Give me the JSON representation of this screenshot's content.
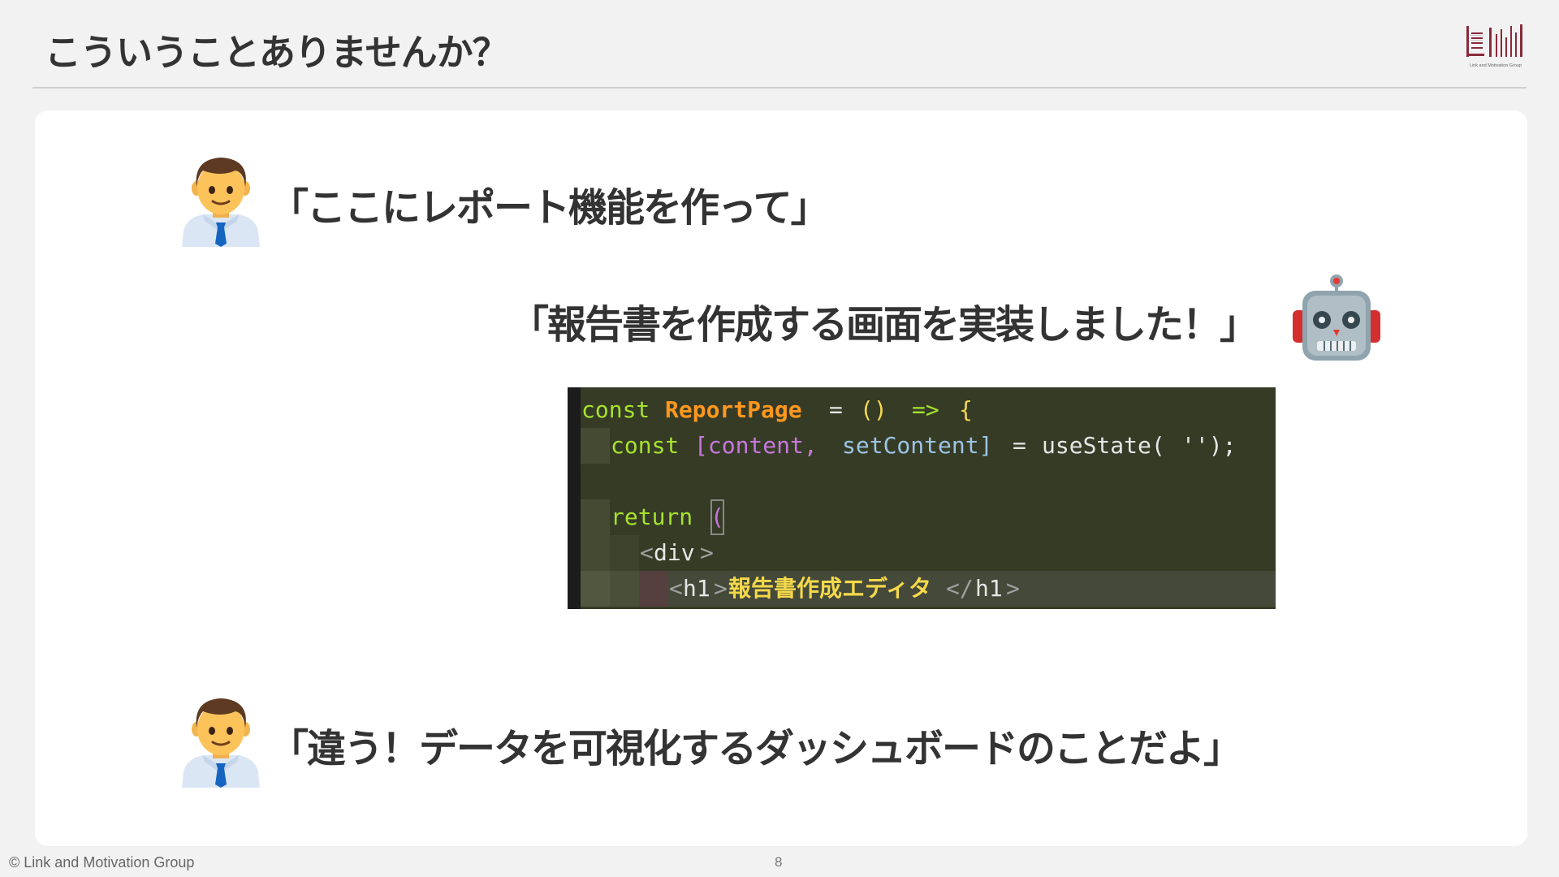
{
  "slide": {
    "title": "こういうことありませんか？",
    "logo_text": "Link and Motivation Group",
    "footer_copyright": "© Link and Motivation Group",
    "page_number": "8"
  },
  "dialogue": [
    {
      "speaker_icon": "businessman-icon",
      "text": "「ここにレポート機能を作って」"
    },
    {
      "speaker_icon": "robot-icon",
      "text": "「報告書を作成する画面を実装しました！」"
    },
    {
      "speaker_icon": "businessman-icon",
      "text": "「違う！データを可視化するダッシュボードのことだよ」"
    }
  ],
  "code": {
    "lines": [
      "const ReportPage = () => {",
      "  const [content, setContent] = useState('');",
      "",
      "  return (",
      "    <div>",
      "      <h1>報告書作成エディタ</h1>"
    ]
  },
  "colors": {
    "code_background": "#363b26",
    "keyword": "#a6e22e",
    "identifier_orange": "#fd971f",
    "bracket_yellow": "#f5d94a",
    "bracket_purple": "#c678dd",
    "function_blue": "#9cc4e4",
    "tag_gray": "#a0a0a0",
    "text_light": "#e6e6e6"
  }
}
